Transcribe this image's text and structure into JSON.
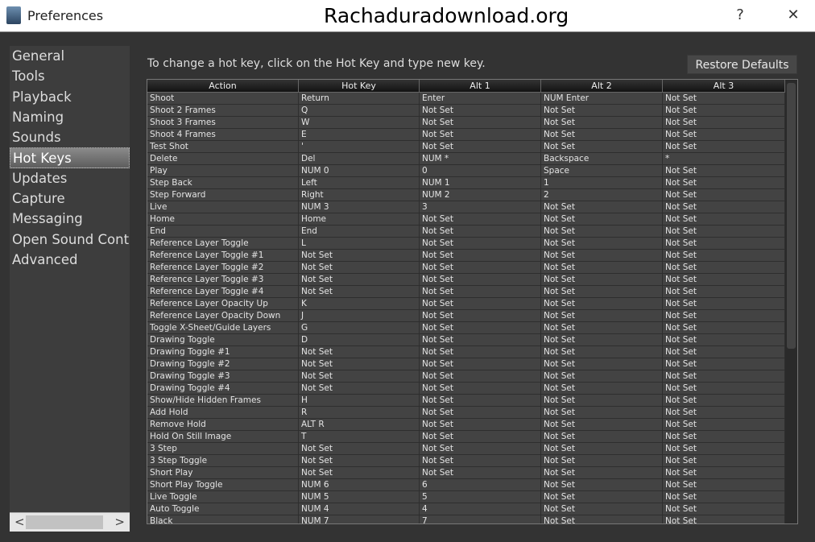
{
  "window": {
    "title": "Preferences",
    "watermark": "Rachaduradownload.org",
    "help": "?",
    "close": "✕"
  },
  "sidebar": {
    "items": [
      "General",
      "Tools",
      "Playback",
      "Naming",
      "Sounds",
      "Hot Keys",
      "Updates",
      "Capture",
      "Messaging",
      "Open Sound Control",
      "Advanced"
    ],
    "selected": "Hot Keys",
    "scroll_left": "<",
    "scroll_right": ">"
  },
  "hint": "To change a hot key, click on the Hot Key and type new key.",
  "restore_label": "Restore Defaults",
  "table": {
    "headers": [
      "Action",
      "Hot Key",
      "Alt 1",
      "Alt 2",
      "Alt 3"
    ],
    "rows": [
      [
        "Shoot",
        "Return",
        "Enter",
        "NUM Enter",
        "Not Set"
      ],
      [
        "Shoot 2 Frames",
        "Q",
        "Not Set",
        "Not Set",
        "Not Set"
      ],
      [
        "Shoot 3 Frames",
        "W",
        "Not Set",
        "Not Set",
        "Not Set"
      ],
      [
        "Shoot 4 Frames",
        "E",
        "Not Set",
        "Not Set",
        "Not Set"
      ],
      [
        "Test Shot",
        "'",
        "Not Set",
        "Not Set",
        "Not Set"
      ],
      [
        "Delete",
        "Del",
        "NUM *",
        "Backspace",
        "*"
      ],
      [
        "Play",
        "NUM 0",
        "0",
        "Space",
        "Not Set"
      ],
      [
        "Step Back",
        "Left",
        "NUM 1",
        "1",
        "Not Set"
      ],
      [
        "Step Forward",
        "Right",
        "NUM 2",
        "2",
        "Not Set"
      ],
      [
        "Live",
        "NUM 3",
        "3",
        "Not Set",
        "Not Set"
      ],
      [
        "Home",
        "Home",
        "Not Set",
        "Not Set",
        "Not Set"
      ],
      [
        "End",
        "End",
        "Not Set",
        "Not Set",
        "Not Set"
      ],
      [
        "Reference Layer Toggle",
        "L",
        "Not Set",
        "Not Set",
        "Not Set"
      ],
      [
        "Reference Layer Toggle #1",
        "Not Set",
        "Not Set",
        "Not Set",
        "Not Set"
      ],
      [
        "Reference Layer Toggle #2",
        "Not Set",
        "Not Set",
        "Not Set",
        "Not Set"
      ],
      [
        "Reference Layer Toggle #3",
        "Not Set",
        "Not Set",
        "Not Set",
        "Not Set"
      ],
      [
        "Reference Layer Toggle #4",
        "Not Set",
        "Not Set",
        "Not Set",
        "Not Set"
      ],
      [
        "Reference Layer Opacity Up",
        "K",
        "Not Set",
        "Not Set",
        "Not Set"
      ],
      [
        "Reference Layer Opacity Down",
        "J",
        "Not Set",
        "Not Set",
        "Not Set"
      ],
      [
        "Toggle X-Sheet/Guide Layers",
        "G",
        "Not Set",
        "Not Set",
        "Not Set"
      ],
      [
        "Drawing Toggle",
        "D",
        "Not Set",
        "Not Set",
        "Not Set"
      ],
      [
        "Drawing Toggle #1",
        "Not Set",
        "Not Set",
        "Not Set",
        "Not Set"
      ],
      [
        "Drawing Toggle #2",
        "Not Set",
        "Not Set",
        "Not Set",
        "Not Set"
      ],
      [
        "Drawing Toggle #3",
        "Not Set",
        "Not Set",
        "Not Set",
        "Not Set"
      ],
      [
        "Drawing Toggle #4",
        "Not Set",
        "Not Set",
        "Not Set",
        "Not Set"
      ],
      [
        "Show/Hide Hidden Frames",
        "H",
        "Not Set",
        "Not Set",
        "Not Set"
      ],
      [
        "Add Hold",
        "R",
        "Not Set",
        "Not Set",
        "Not Set"
      ],
      [
        "Remove Hold",
        "ALT R",
        "Not Set",
        "Not Set",
        "Not Set"
      ],
      [
        "Hold On Still Image",
        "T",
        "Not Set",
        "Not Set",
        "Not Set"
      ],
      [
        "3 Step",
        "Not Set",
        "Not Set",
        "Not Set",
        "Not Set"
      ],
      [
        "3 Step Toggle",
        "Not Set",
        "Not Set",
        "Not Set",
        "Not Set"
      ],
      [
        "Short Play",
        "Not Set",
        "Not Set",
        "Not Set",
        "Not Set"
      ],
      [
        "Short Play Toggle",
        "NUM 6",
        "6",
        "Not Set",
        "Not Set"
      ],
      [
        "Live Toggle",
        "NUM 5",
        "5",
        "Not Set",
        "Not Set"
      ],
      [
        "Auto Toggle",
        "NUM 4",
        "4",
        "Not Set",
        "Not Set"
      ],
      [
        "Black",
        "NUM 7",
        "7",
        "Not Set",
        "Not Set"
      ]
    ]
  }
}
